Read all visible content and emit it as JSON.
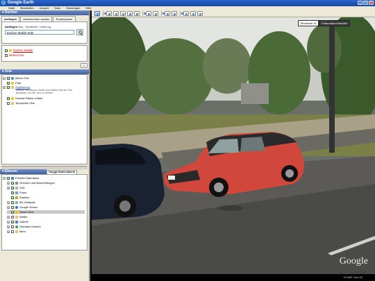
{
  "window": {
    "title": "Google Earth",
    "controls": [
      "_",
      "□",
      "×"
    ]
  },
  "menu": [
    "Datei",
    "Bearbeiten",
    "Ansicht",
    "Tools",
    "Hinzufügen",
    "Hilfe"
  ],
  "search": {
    "header": "Suchen",
    "tabs": [
      "Anfliegen",
      "Unternehmen suchen",
      "Routenplaner"
    ],
    "hint_label": "Anfliegen",
    "hint_text": "Bsp.: Stadtmitte, Hamburg",
    "value": "Eschen Straße Köln",
    "results": [
      {
        "label": "Eschen Straße",
        "checked": true
      },
      {
        "label": "Meinen Ew",
        "checked": false
      }
    ],
    "clear_label": "×"
  },
  "places": {
    "header": "Orte",
    "items": [
      {
        "label": "Meine Orte",
        "sub": ""
      },
      {
        "label": "Park",
        "sub": ""
      },
      {
        "label": "Sightseeing",
        "sub": "Wählen Sie diesen Ordner und klicken Sie auf Tour abspielen, um die Tour zu starten."
      },
      {
        "label": "Victoria Palace Urlaub",
        "sub": ""
      },
      {
        "label": "Temporäre Orte",
        "sub": ""
      }
    ]
  },
  "layers": {
    "header": "Ebenen",
    "gallery_label": "Google Earth-Galerie",
    "items": [
      {
        "label": "Primäre Datenbank",
        "checked": true
      },
      {
        "label": "Grenzen und Beschriftungen",
        "checked": true
      },
      {
        "label": "Orte",
        "checked": true
      },
      {
        "label": "Fotos",
        "checked": true
      },
      {
        "label": "Straßen",
        "checked": true
      },
      {
        "label": "3D-Gebäude",
        "checked": true
      },
      {
        "label": "Google Ocean",
        "checked": true
      },
      {
        "label": "Street View",
        "checked": true
      },
      {
        "label": "Wetter",
        "checked": false
      },
      {
        "label": "Galerie",
        "checked": true
      },
      {
        "label": "Globales Denken",
        "checked": false
      },
      {
        "label": "Mehr",
        "checked": false
      }
    ]
  },
  "viewer": {
    "exit_label": "Eindrücke Vt",
    "mode_label": "Fotomodus beenden",
    "logo": "Google",
    "status": "S-GAR Ymu 52"
  },
  "colors": {
    "titlebar": "#1f57bb",
    "panel": "#ece9d8",
    "link": "#cc0000",
    "car_red": "#d2473b"
  }
}
